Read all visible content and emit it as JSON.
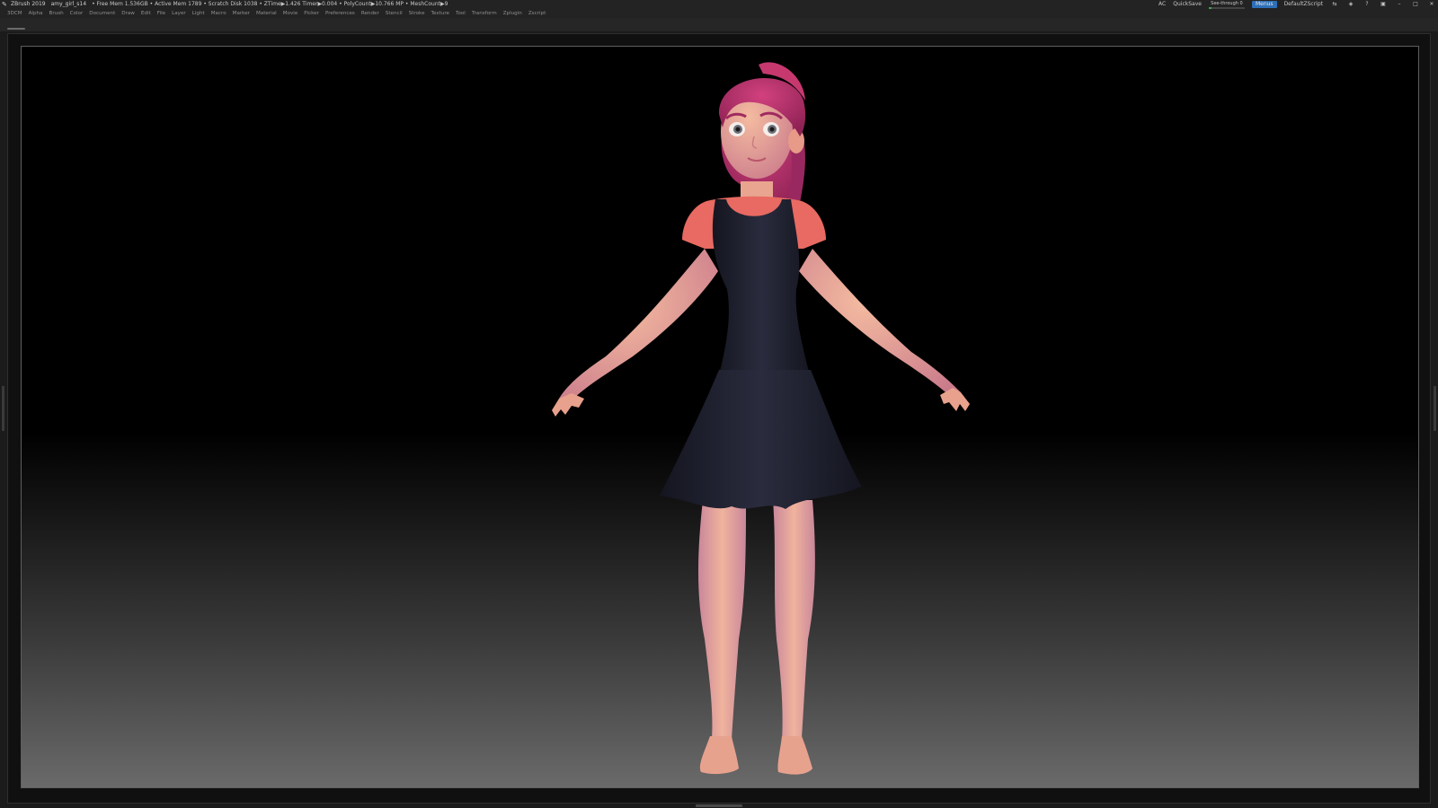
{
  "titlebar": {
    "app_title": "ZBrush 2019",
    "doc_name": "amy_girl_s14",
    "stats": "• Free Mem 1.536GB • Active Mem 1789 • Scratch Disk 1038 • ZTime▶1.426 Timer▶0.004 • PolyCount▶10.766 MP • MeshCount▶9",
    "ac": "AC",
    "quicksave": "QuickSave",
    "see_through_label": "See-through  0",
    "see_through_value": 0,
    "menus_label": "Menus",
    "default_script": "DefaultZScript"
  },
  "menubar": {
    "items": [
      "3DCM",
      "Alpha",
      "Brush",
      "Color",
      "Document",
      "Draw",
      "Edit",
      "File",
      "Layer",
      "Light",
      "Macro",
      "Marker",
      "Material",
      "Movie",
      "Picker",
      "Preferences",
      "Render",
      "Stencil",
      "Stroke",
      "Texture",
      "Tool",
      "Transform",
      "Zplugin",
      "Zscript"
    ]
  },
  "colors": {
    "skin": "#e8a58f",
    "hair": "#b8306b",
    "tshirt": "#e86a62",
    "dress": "#1c1e2c",
    "accent": "#2d6fb8"
  }
}
